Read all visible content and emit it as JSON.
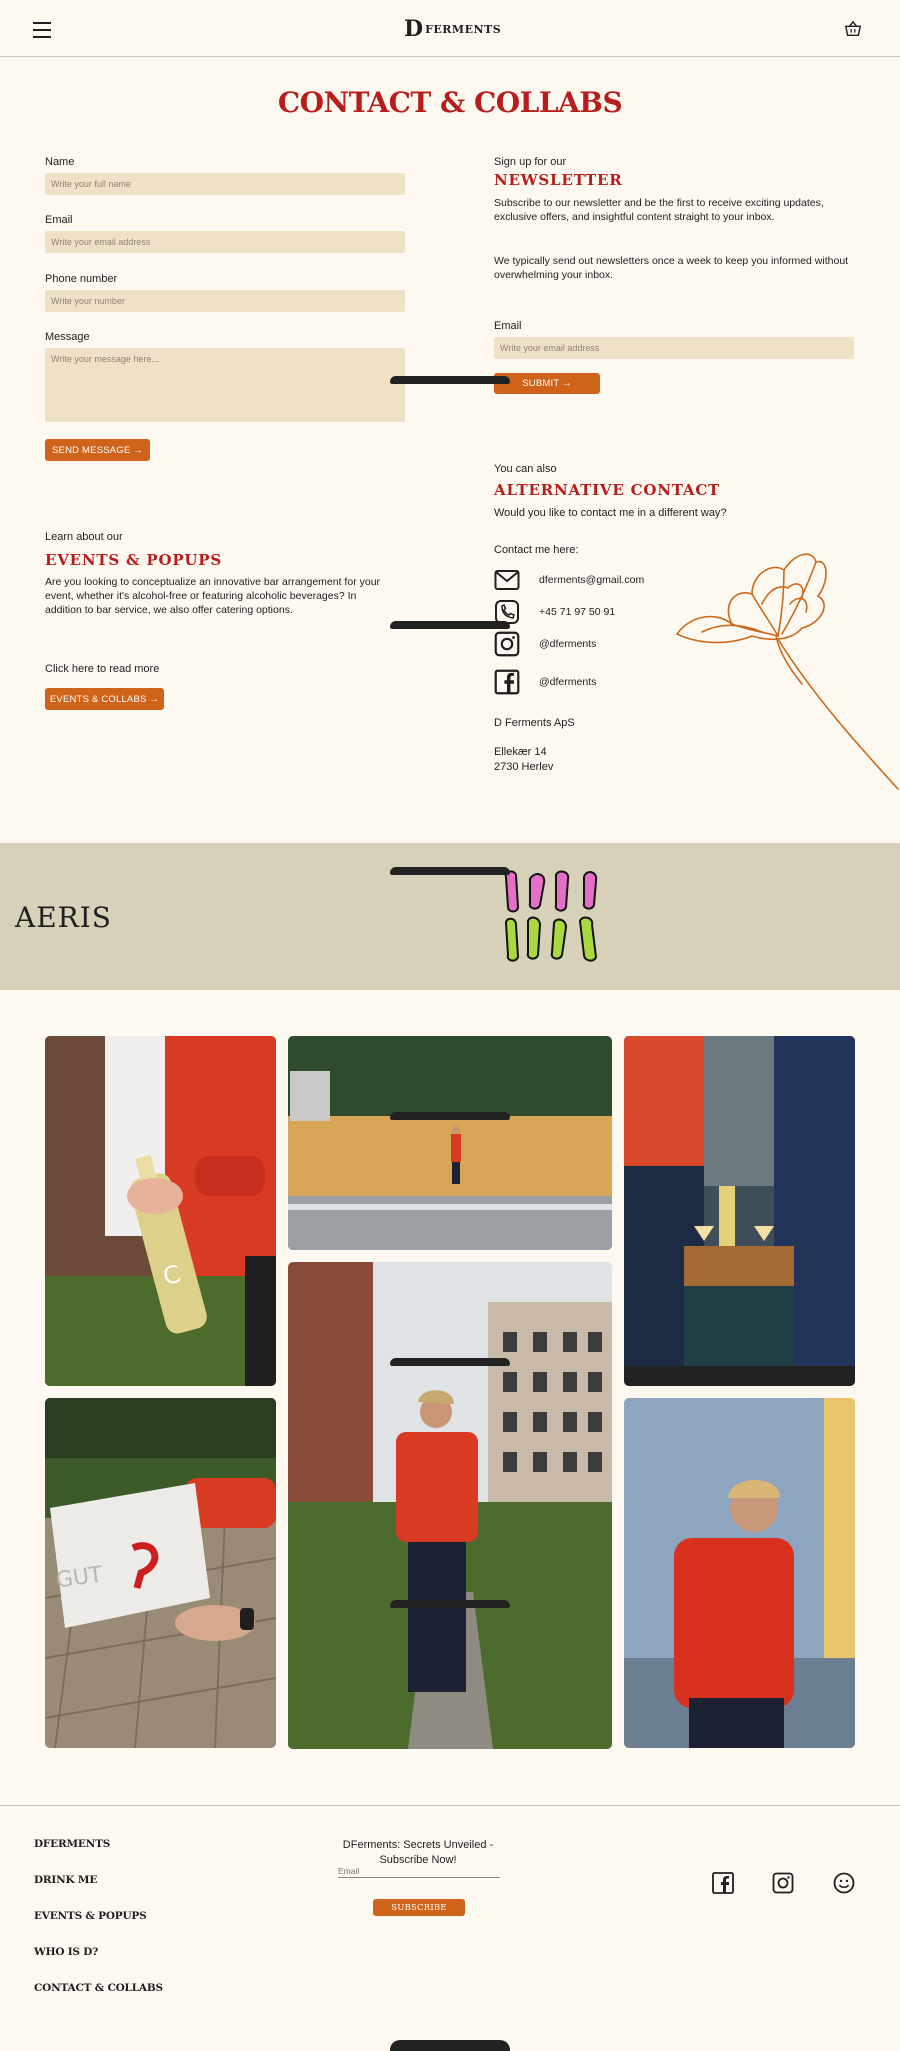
{
  "header": {
    "logo_mark": "D",
    "logo_text": "FERMENTS"
  },
  "page_title": "CONTACT & COLLABS",
  "form": {
    "name_label": "Name",
    "name_placeholder": "Write your full name",
    "email_label": "Email",
    "email_placeholder": "Write your email address",
    "phone_label": "Phone number",
    "phone_placeholder": "Write your number",
    "message_label": "Message",
    "message_placeholder": "Write your message here...",
    "send_label": "SEND MESSAGE →"
  },
  "newsletter": {
    "kicker": "Sign up for our",
    "heading": "NEWSLETTER",
    "para1": "Subscribe to our newsletter and be the first to receive exciting updates, exclusive offers, and insightful content straight to your inbox.",
    "para2": "We typically send out newsletters once a week to keep you informed without overwhelming your inbox.",
    "email_label": "Email",
    "email_placeholder": "Write your email address",
    "submit_label": "SUBMIT →"
  },
  "events": {
    "kicker": "Learn about our",
    "heading": "EVENTS & POPUPS",
    "para": "Are you looking to conceptualize an innovative bar arrangement for your event, whether it's alcohol-free or featuring alcoholic beverages? In addition to bar service, we also offer catering options.",
    "read_more": "Click here to read more",
    "button_label": "EVENTS & COLLABS →"
  },
  "alt_contact": {
    "kicker": "You can also",
    "heading": "ALTERNATIVE CONTACT",
    "question": "Would you like to contact me in a different way?",
    "contact_me": "Contact me here:",
    "email": "dferments@gmail.com",
    "phone": "+45 71 97 50 91",
    "instagram": "@dferments",
    "facebook": "@dferments",
    "company": "D Ferments ApS",
    "address_line1": "Ellekær 14",
    "address_line2": "2730 Herlev"
  },
  "banner": {
    "aeris": "AERIS"
  },
  "footer": {
    "links": [
      "DFERMENTS",
      "DRINK ME",
      "EVENTS & POPUPS",
      "WHO IS D?",
      "CONTACT & COLLABS"
    ],
    "news_text": "DFerments: Secrets Unveiled - Subscribe Now!",
    "email_placeholder": "Email",
    "subscribe_label": "SUBSCRIBE"
  },
  "colors": {
    "accent_red": "#b71d1b",
    "accent_orange": "#d0631a",
    "field_bg": "#efe1c5",
    "page_bg": "#fdf9f1",
    "banner_bg": "#d8d1b9"
  }
}
